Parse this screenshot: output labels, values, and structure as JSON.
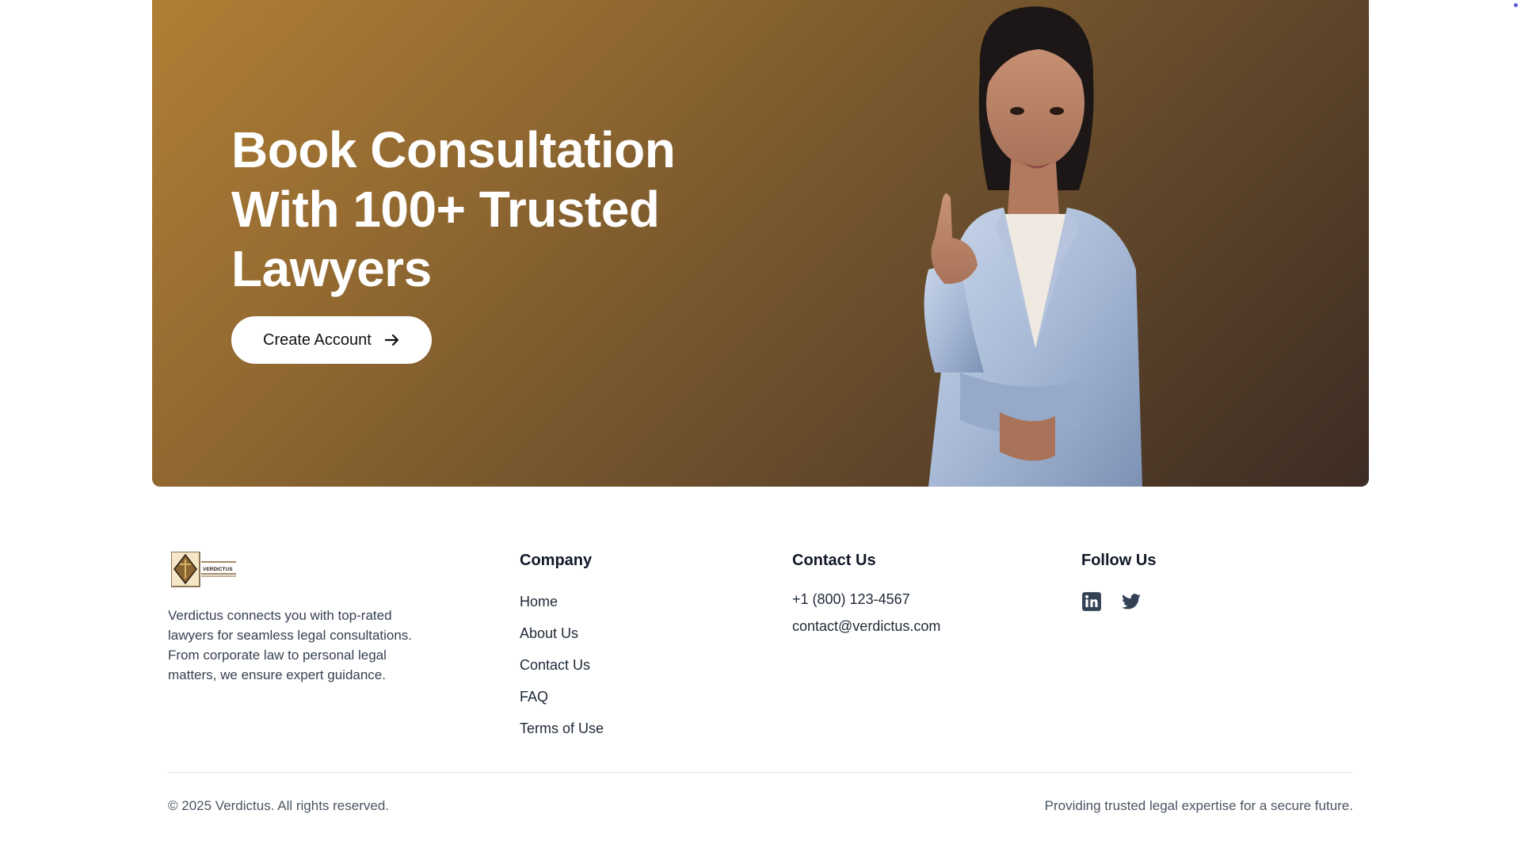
{
  "hero": {
    "title_lines": [
      "Book Consultation",
      "With 100+ Trusted",
      "Lawyers"
    ],
    "cta_label": "Create Account",
    "gradient_colors": [
      "#b07f35",
      "#8f6730",
      "#6a4e2c",
      "#3d2c24"
    ]
  },
  "footer": {
    "brand_name": "VERDICTUS",
    "about_text": "Verdictus connects you with top-rated lawyers for seamless legal consultations. From corporate law to personal legal matters, we ensure expert guidance.",
    "company": {
      "heading": "Company",
      "links": [
        "Home",
        "About Us",
        "Contact Us",
        "FAQ",
        "Terms of Use"
      ]
    },
    "contact": {
      "heading": "Contact Us",
      "phone": "+1 (800) 123-4567",
      "email": "contact@verdictus.com"
    },
    "follow": {
      "heading": "Follow Us",
      "icons": [
        "linkedin-icon",
        "twitter-icon"
      ]
    },
    "copyright": "© 2025 Verdictus. All rights reserved.",
    "tagline": "Providing trusted legal expertise for a secure future."
  }
}
